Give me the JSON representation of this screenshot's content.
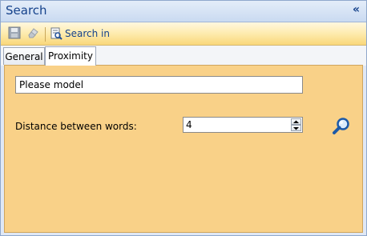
{
  "panel": {
    "title": "Search"
  },
  "toolbar": {
    "search_in_label": "Search in"
  },
  "tabs": [
    {
      "label": "General"
    },
    {
      "label": "Proximity"
    }
  ],
  "proximity": {
    "text_value": "Please model",
    "distance_label": "Distance between words:",
    "distance_value": "4"
  },
  "colors": {
    "content_bg": "#f9d188",
    "title_text": "#15428b",
    "toolbar_gold": "#fde9a8"
  }
}
